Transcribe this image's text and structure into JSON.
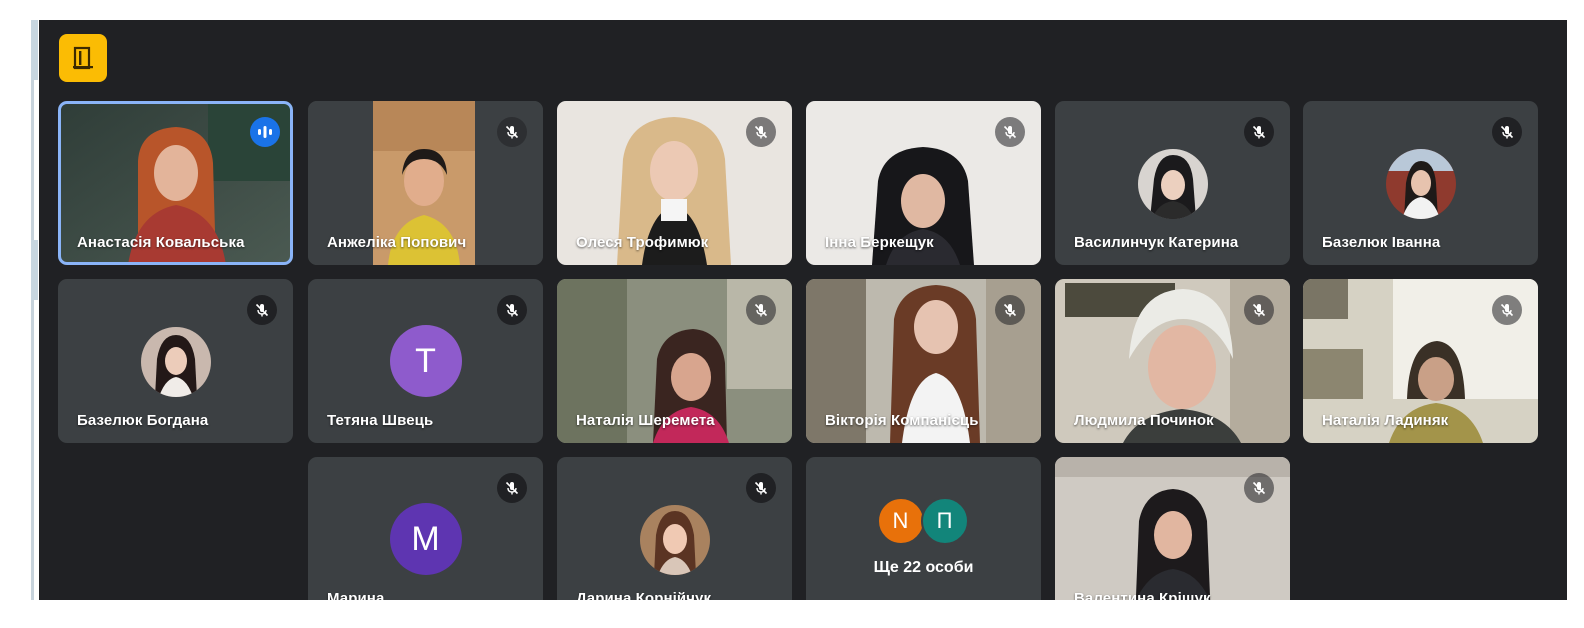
{
  "meeting": {
    "brand_icon": "door-exit-icon",
    "colors": {
      "background": "#202124",
      "tile": "#3c4043",
      "brand": "#fbbc04",
      "speaking": "#1a73e8",
      "active_border": "#8ab4f8"
    }
  },
  "tiles": [
    {
      "name": "Анастасія Ковальська",
      "type": "video",
      "speaking": true
    },
    {
      "name": "Анжеліка Попович",
      "type": "video",
      "muted": true
    },
    {
      "name": "Олеся Трофимюк",
      "type": "video",
      "muted": true
    },
    {
      "name": "Інна Беркещук",
      "type": "video",
      "muted": true
    },
    {
      "name": "Василинчук Катерина",
      "type": "avatar-photo",
      "muted": true
    },
    {
      "name": "Базелюк Іванна",
      "type": "avatar-photo",
      "muted": true
    },
    {
      "name": "Базелюк Богдана",
      "type": "avatar-photo",
      "muted": true
    },
    {
      "name": "Тетяна Швець",
      "type": "avatar-letter",
      "letter": "Т",
      "color": "#8e5bcc",
      "muted": true
    },
    {
      "name": "Наталія Шеремета",
      "type": "video",
      "muted": true
    },
    {
      "name": "Вікторія Компанієць",
      "type": "video",
      "muted": true
    },
    {
      "name": "Людмила Починок",
      "type": "video",
      "muted": true
    },
    {
      "name": "Наталія Ладиняк",
      "type": "video",
      "muted": true
    },
    {
      "name": "Марина",
      "type": "avatar-letter",
      "letter": "М",
      "color": "#5e35b1",
      "muted": true
    },
    {
      "name": "Дарина Корнійчук",
      "type": "avatar-photo",
      "muted": true
    },
    {
      "name": "Валентина Кріщук",
      "type": "video",
      "muted": true
    }
  ],
  "more": {
    "label": "Ще 22 особи",
    "avatars": [
      {
        "letter": "N",
        "color": "#e8710a"
      },
      {
        "letter": "П",
        "color": "#12857a"
      }
    ]
  }
}
